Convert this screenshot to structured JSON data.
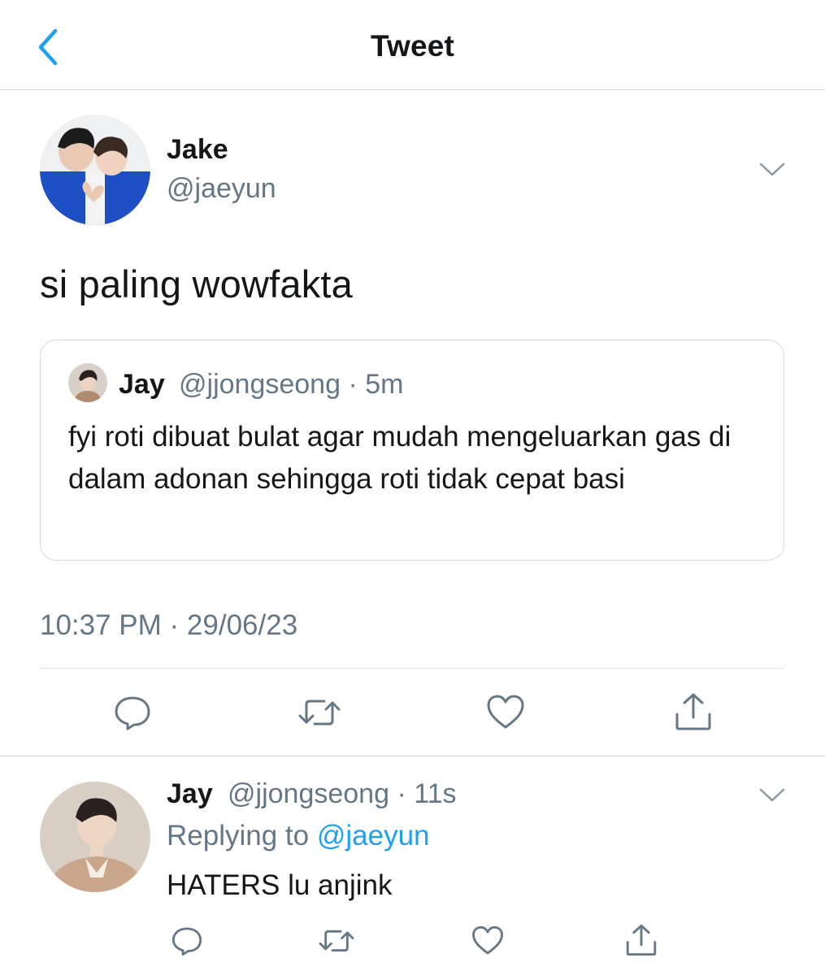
{
  "header": {
    "title": "Tweet"
  },
  "tweet": {
    "author_name": "Jake",
    "author_handle": "@jaeyun",
    "text": "si paling wowfakta",
    "timestamp": "10:37 PM · 29/06/23"
  },
  "quoted_tweet": {
    "author_name": "Jay",
    "author_handle": "@jjongseong",
    "time": "5m",
    "text": "fyi roti dibuat bulat agar mudah mengeluarkan gas di dalam adonan sehingga roti tidak cepat basi"
  },
  "reply": {
    "author_name": "Jay",
    "author_handle": "@jjongseong",
    "time": "11s",
    "replying_to_label": "Replying to",
    "replying_to_handle": "@jaeyun",
    "text": "HATERS lu anjink"
  },
  "colors": {
    "accent": "#1da1f2",
    "secondary_text": "#657786",
    "divider": "#d6d9dc",
    "avatar_blue": "#1f4fc4",
    "avatar_tan": "#c9a68b"
  },
  "icons": {
    "back": "chevron-left-icon",
    "menu": "chevron-down-icon",
    "reply": "reply-icon",
    "retweet": "retweet-icon",
    "like": "heart-icon",
    "share": "share-icon"
  }
}
